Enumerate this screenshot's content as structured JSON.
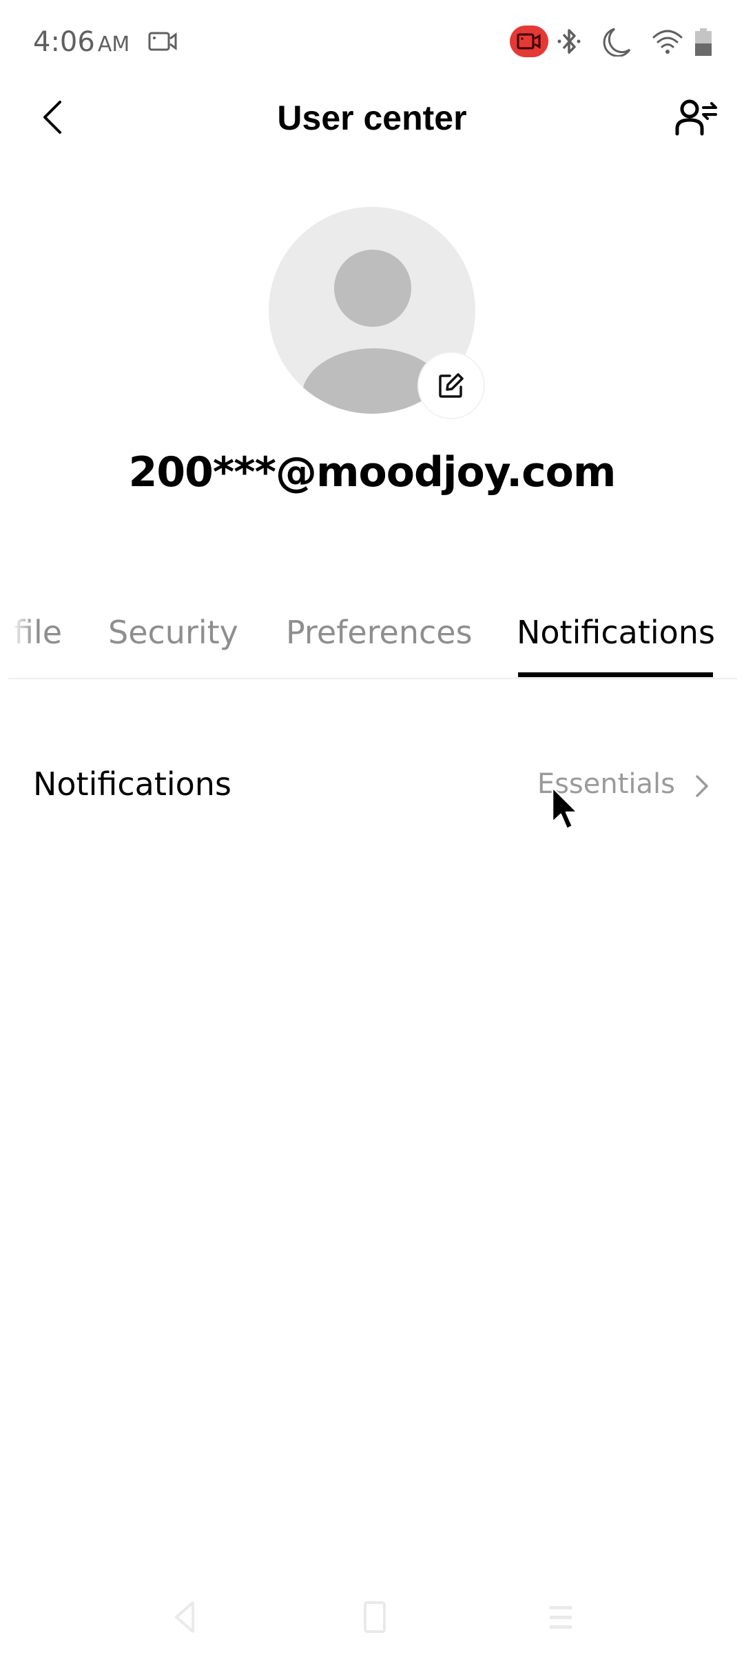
{
  "status_bar": {
    "time": "4:06",
    "ampm": "AM",
    "left_icons": [
      "screen-record-icon"
    ],
    "right_icons": [
      "recording-indicator-icon",
      "bluetooth-icon",
      "do-not-disturb-moon-icon",
      "wifi-icon",
      "battery-icon"
    ],
    "recording_color": "#e53935",
    "battery_level": 0.5
  },
  "header": {
    "title": "User center",
    "back_icon": "chevron-left-icon",
    "right_icon": "switch-account-icon"
  },
  "profile": {
    "avatar_icon": "default-avatar-icon",
    "edit_icon": "edit-pencil-icon",
    "email": "200***@moodjoy.com"
  },
  "tabs": {
    "items": [
      {
        "label": "file",
        "full_label": "Profile",
        "active": false
      },
      {
        "label": "Security",
        "active": false
      },
      {
        "label": "Preferences",
        "active": false
      },
      {
        "label": "Notifications",
        "active": true
      }
    ],
    "active_color": "#000000",
    "inactive_color": "#8e8e8e"
  },
  "settings": {
    "rows": [
      {
        "label": "Notifications",
        "value": "Essentials",
        "icon": "chevron-right-icon"
      }
    ]
  },
  "nav_bar": {
    "icons": [
      "nav-back-icon",
      "nav-home-icon",
      "nav-recents-icon"
    ]
  }
}
